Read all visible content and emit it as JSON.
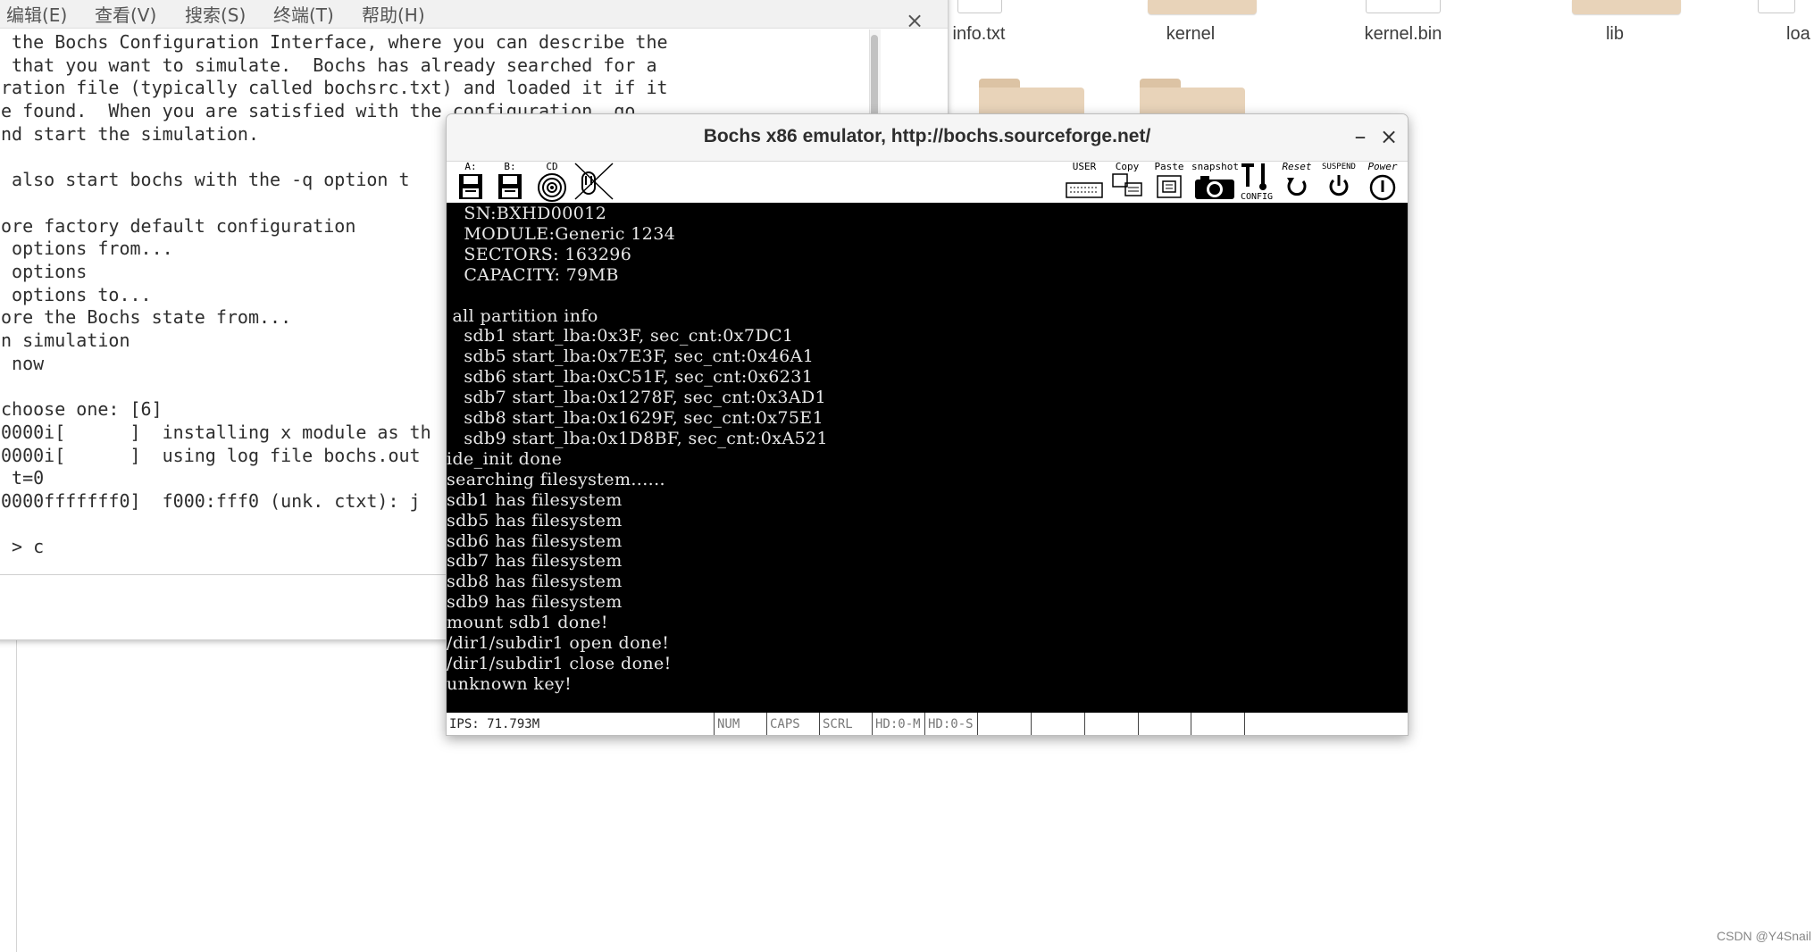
{
  "file_manager": {
    "files": [
      {
        "name": "info.txt",
        "kind": "file"
      },
      {
        "name": "kernel",
        "kind": "folder"
      },
      {
        "name": "kernel.bin",
        "kind": "file"
      },
      {
        "name": "lib",
        "kind": "folder"
      },
      {
        "name": "loa",
        "kind": "file"
      }
    ]
  },
  "terminal": {
    "menu": [
      "编辑(E)",
      "查看(V)",
      "搜索(S)",
      "终端(T)",
      "帮助(H)"
    ],
    "close_icon": "×",
    "lines": [
      " the Bochs Configuration Interface, where you can describe the",
      " that you want to simulate.  Bochs has already searched for a",
      "ration file (typically called bochsrc.txt) and loaded it if it",
      "e found.  When you are satisfied with the configuration, go",
      "nd start the simulation.",
      "",
      " also start bochs with the -q option t",
      "",
      "ore factory default configuration",
      " options from...",
      " options",
      " options to...",
      "ore the Bochs state from...",
      "n simulation",
      " now",
      "",
      "choose one: [6]",
      "0000i[      ]  installing x module as th",
      "0000i[      ]  using log file bochs.out",
      " t=0",
      "0000fffffff0]  f000:fff0 (unk. ctxt): j",
      "",
      " > c"
    ]
  },
  "bochs": {
    "title": "Bochs x86 emulator, http://bochs.sourceforge.net/",
    "minimize_icon": "–",
    "close_icon": "×",
    "toolbar_left": [
      {
        "label": "A:",
        "icon": "floppy-a-icon"
      },
      {
        "label": "B:",
        "icon": "floppy-b-icon"
      },
      {
        "label": "CD",
        "icon": "cdrom-icon"
      },
      {
        "label": "",
        "icon": "mouse-icon"
      }
    ],
    "toolbar_right": [
      {
        "label": "USER",
        "icon": "keyboard-icon"
      },
      {
        "label": "Copy",
        "icon": "copy-icon"
      },
      {
        "label": "Paste",
        "icon": "paste-icon"
      },
      {
        "label": "snapshot",
        "icon": "camera-icon"
      },
      {
        "label": "CONFIG",
        "icon": "config-icon"
      },
      {
        "label": "Reset",
        "icon": "reset-icon"
      },
      {
        "label": "SUSPEND",
        "icon": "suspend-icon"
      },
      {
        "label": "Power",
        "icon": "power-icon"
      }
    ],
    "screen_lines": [
      "   SN:BXHD00012",
      "   MODULE:Generic 1234",
      "   SECTORS: 163296",
      "   CAPACITY: 79MB",
      "",
      " all partition info",
      "   sdb1 start_lba:0x3F, sec_cnt:0x7DC1",
      "   sdb5 start_lba:0x7E3F, sec_cnt:0x46A1",
      "   sdb6 start_lba:0xC51F, sec_cnt:0x6231",
      "   sdb7 start_lba:0x1278F, sec_cnt:0x3AD1",
      "   sdb8 start_lba:0x1629F, sec_cnt:0x75E1",
      "   sdb9 start_lba:0x1D8BF, sec_cnt:0xA521",
      "ide_init done",
      "searching filesystem......",
      "sdb1 has filesystem",
      "sdb5 has filesystem",
      "sdb6 has filesystem",
      "sdb7 has filesystem",
      "sdb8 has filesystem",
      "sdb9 has filesystem",
      "mount sdb1 done!",
      "/dir1/subdir1 open done!",
      "/dir1/subdir1 close done!",
      "unknown key!"
    ],
    "status": {
      "ips": "IPS: 71.793M",
      "indicators": [
        "NUM",
        "CAPS",
        "SCRL",
        "HD:0-M",
        "HD:0-S",
        "",
        "",
        "",
        "",
        "",
        ""
      ]
    }
  },
  "watermark": "CSDN @Y4Snail"
}
